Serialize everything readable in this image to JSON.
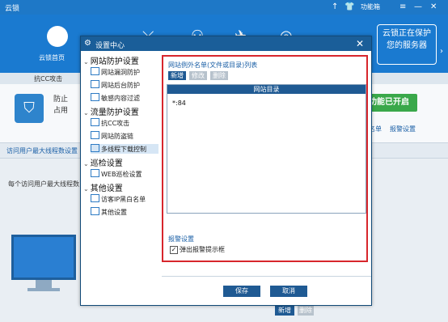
{
  "window": {
    "title": "云锁",
    "feature_box": "功能箱"
  },
  "nav": {
    "home_label": "云锁首页",
    "promo_line1": "云锁正在保护",
    "promo_line2": "您的服务器"
  },
  "subbar": {
    "tab": "抗CC攻击"
  },
  "banner": {
    "line1": "防止",
    "line2": "占用",
    "enabled": "功能已开启",
    "link_whitelist": "名单",
    "link_alarm": "报警设置"
  },
  "section": {
    "title": "访问用户最大线程数设置",
    "desc": "每个访问用户最大线程数"
  },
  "bottom": {
    "add": "新增",
    "delete": "删除"
  },
  "dialog": {
    "title": "设置中心",
    "groups": [
      {
        "label": "网站防护设置",
        "items": [
          "网站漏洞防护",
          "网站后台防护",
          "敏感内容过滤"
        ]
      },
      {
        "label": "流量防护设置",
        "items": [
          "抗CC攻击",
          "网站防盗链",
          "多线程下载控制"
        ]
      },
      {
        "label": "巡检设置",
        "items": [
          "WEB巡检设置"
        ]
      },
      {
        "label": "其他设置",
        "items": [
          "访客IP黑白名单",
          "其他设置"
        ]
      }
    ],
    "pane": {
      "title": "网站例外名单(文件或目录)列表",
      "btn_new": "新增",
      "btn_edit": "修改",
      "btn_delete": "删除",
      "table_header": "网站目录",
      "rows": [
        "*:84"
      ],
      "alarm_title": "报警设置",
      "alarm_checkbox": "弹出报警提示框"
    },
    "save": "保存",
    "cancel": "取消"
  }
}
